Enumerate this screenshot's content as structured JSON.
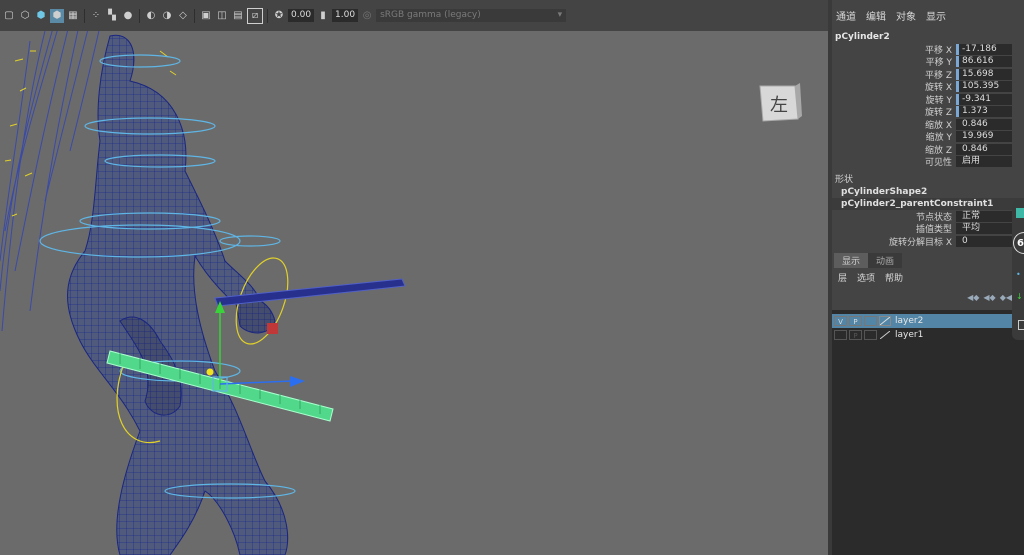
{
  "toolbar": {
    "exposure": "0.00",
    "gamma": "1.00",
    "colorspace": "sRGB gamma (legacy)"
  },
  "viewcube": {
    "label": "左"
  },
  "channel_box": {
    "menu": [
      "通道",
      "编辑",
      "对象",
      "显示"
    ],
    "object_name": "pCylinder2",
    "attributes": [
      {
        "label": "平移 X",
        "value": "-17.186"
      },
      {
        "label": "平移 Y",
        "value": "86.616"
      },
      {
        "label": "平移 Z",
        "value": "15.698"
      },
      {
        "label": "旋转 X",
        "value": "105.395"
      },
      {
        "label": "旋转 Y",
        "value": "-9.341"
      },
      {
        "label": "旋转 Z",
        "value": "1.373"
      },
      {
        "label": "缩放 X",
        "value": "0.846"
      },
      {
        "label": "缩放 Y",
        "value": "19.969"
      },
      {
        "label": "缩放 Z",
        "value": "0.846"
      },
      {
        "label": "可见性",
        "value": "启用"
      }
    ],
    "shapes_label": "形状",
    "shape_nodes": [
      "pCylinderShape2",
      "pCylinder2_parentConstraint1"
    ],
    "constraint_attrs": [
      {
        "label": "节点状态",
        "value": "正常"
      },
      {
        "label": "插值类型",
        "value": "平均"
      },
      {
        "label": "旋转分解目标 X",
        "value": "0"
      }
    ]
  },
  "layer_editor": {
    "tabs": [
      "显示",
      "动画"
    ],
    "menu": [
      "层",
      "选项",
      "帮助"
    ],
    "layers": [
      {
        "v": "V",
        "p": "P",
        "name": "layer2",
        "selected": true
      },
      {
        "v": "",
        "p": "P",
        "name": "layer1",
        "selected": false
      }
    ]
  },
  "edge_widget": {
    "number": "6"
  }
}
